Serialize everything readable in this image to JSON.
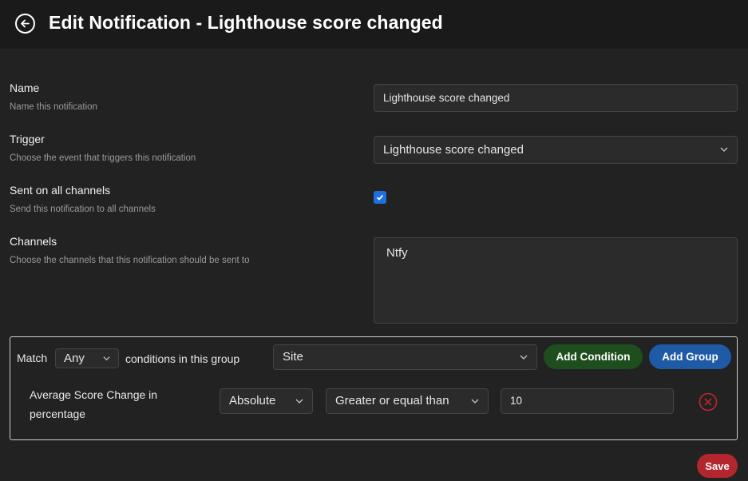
{
  "header": {
    "title": "Edit Notification - Lighthouse score changed",
    "back_icon": "arrow-left-circle-icon"
  },
  "form": {
    "name": {
      "label": "Name",
      "description": "Name this notification",
      "value": "Lighthouse score changed"
    },
    "trigger": {
      "label": "Trigger",
      "description": "Choose the event that triggers this notification",
      "value": "Lighthouse score changed"
    },
    "all_channels": {
      "label": "Sent on all channels",
      "description": "Send this notification to all channels",
      "checked": true
    },
    "channels": {
      "label": "Channels",
      "description": "Choose the channels that this notification should be sent to",
      "values": [
        "Ntfy"
      ]
    }
  },
  "group": {
    "match_label": "Match",
    "match_value": "Any",
    "conditions_text": "conditions in this group",
    "scope_value": "Site",
    "add_condition_label": "Add Condition",
    "add_group_label": "Add Group",
    "condition": {
      "field_line1": "Average Score Change in",
      "field_line2": "percentage",
      "mode_value": "Absolute",
      "operator_value": "Greater or equal than",
      "amount_value": "10"
    }
  },
  "actions": {
    "save_label": "Save"
  },
  "colors": {
    "add_condition": "#1e4d1e",
    "add_group": "#1f5aa6",
    "save": "#b3262d",
    "remove": "#c0272d",
    "checkbox": "#1e6fe0"
  }
}
